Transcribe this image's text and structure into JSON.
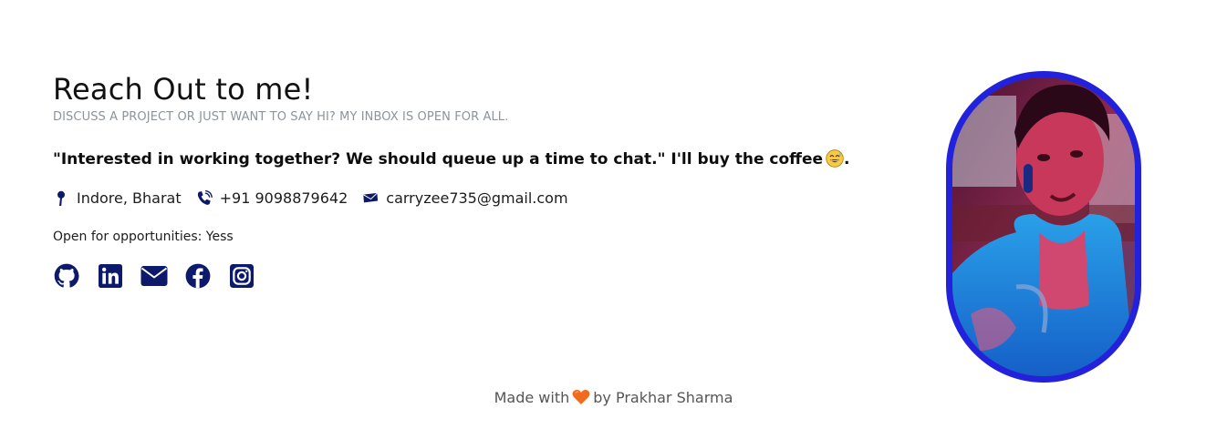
{
  "contact": {
    "title": "Reach Out to me!",
    "subtitle": "DISCUSS A PROJECT OR JUST WANT TO SAY HI? MY INBOX IS OPEN FOR ALL.",
    "quote": "\"Interested in working together? We should queue up a time to chat.\" I'll buy the coffee",
    "quote_end": ".",
    "location": "Indore, Bharat",
    "phone": "+91 9098879642",
    "email": "carryzee735@gmail.com",
    "status": "Open for opportunities: Yess",
    "icons": {
      "location": "location-pin-icon",
      "phone": "phone-icon",
      "email": "envelope-icon",
      "emoji": "grinning-sweat-emoji"
    },
    "socials": [
      {
        "name": "github",
        "icon": "github-icon"
      },
      {
        "name": "linkedin",
        "icon": "linkedin-icon"
      },
      {
        "name": "email",
        "icon": "mail-icon"
      },
      {
        "name": "facebook",
        "icon": "facebook-icon"
      },
      {
        "name": "instagram",
        "icon": "instagram-icon"
      }
    ]
  },
  "avatar": {
    "border_color": "#2222dd"
  },
  "footer": {
    "prefix": "Made with",
    "suffix": "by Prakhar Sharma",
    "heart_icon": "heart-icon",
    "heart_color": "#f26a1b"
  },
  "colors": {
    "icon": "#0d1a6b",
    "subtitle": "#8c949c",
    "text": "#111111"
  }
}
